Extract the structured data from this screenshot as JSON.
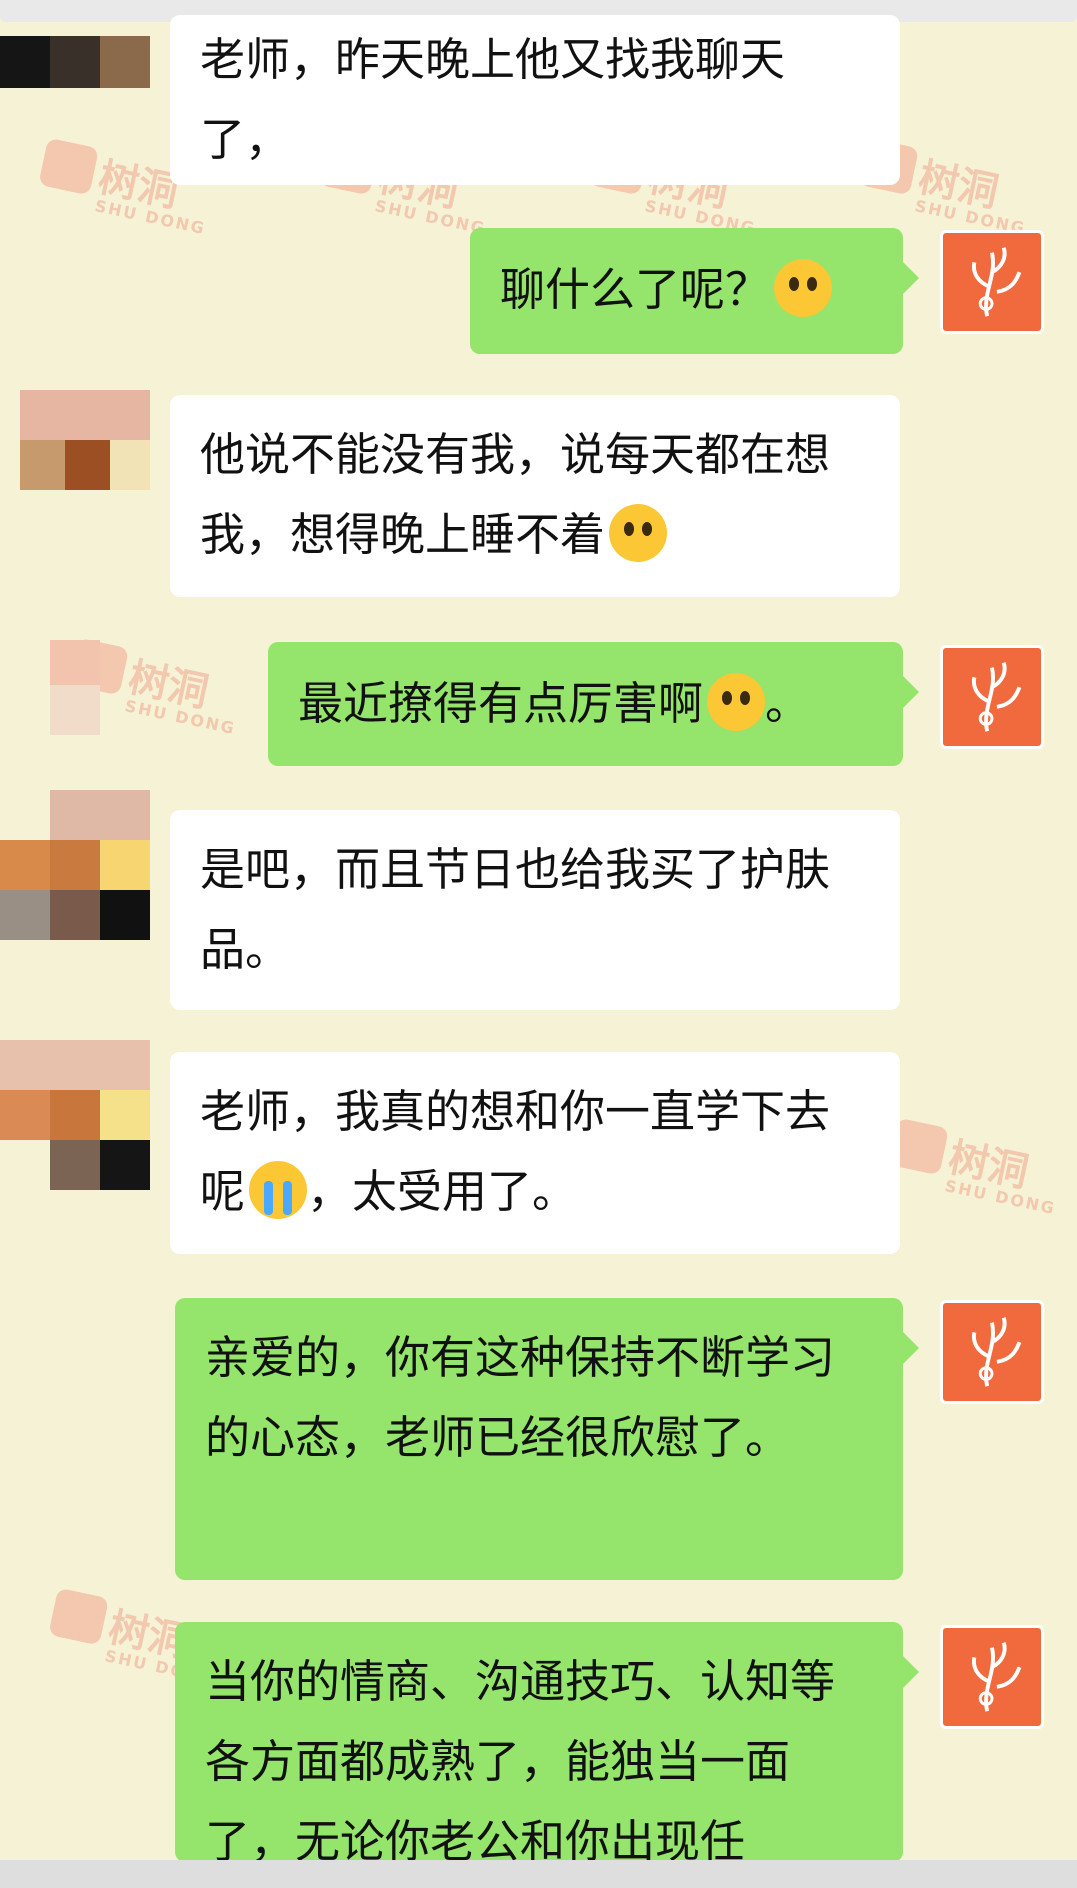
{
  "messages": [
    {
      "side": "in",
      "text": "老师，昨天晚上他又找我聊天了，"
    },
    {
      "side": "out",
      "text": "聊什么了呢？",
      "emoji": "flushed-face-icon"
    },
    {
      "side": "in",
      "text": "他说不能没有我，说每天都在想我，想得晚上睡不着",
      "emoji": "hand-over-mouth-face-icon"
    },
    {
      "side": "out",
      "text": "最近撩得有点厉害啊",
      "emoji": "thinking-face-icon",
      "tail": "。"
    },
    {
      "side": "in",
      "text": "是吧，而且节日也给我买了护肤品。"
    },
    {
      "side": "in",
      "text": "老师，我真的想和你一直学下去呢",
      "emoji": "loudly-crying-face-icon",
      "tail": "，太受用了。"
    },
    {
      "side": "out",
      "text": "亲爱的，你有这种保持不断学习的心态，老师已经很欣慰了。"
    },
    {
      "side": "out",
      "text": "当你的情商、沟通技巧、认知等各方面都成熟了，能独当一面了，无论你老公和你出现任"
    }
  ],
  "watermark": {
    "brand": "树洞",
    "sub": "SHU DONG"
  },
  "colors": {
    "incoming": "#ffffff",
    "outgoing": "#95e46b",
    "avatar": "#f06a3d",
    "background": "#f6f2d6"
  }
}
